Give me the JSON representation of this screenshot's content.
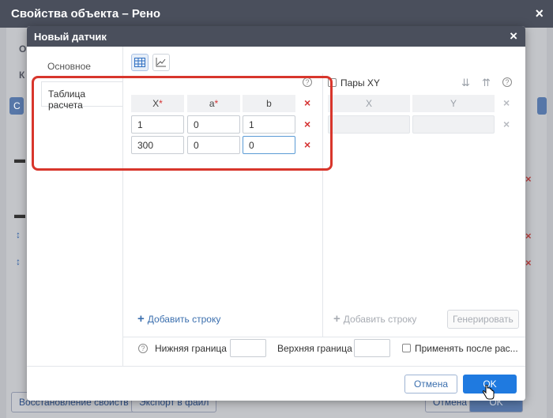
{
  "outer_dialog": {
    "title": "Свойства объекта – Рено",
    "fragment_1": "О",
    "fragment_2": "К",
    "fragment_3": "С",
    "restore_button": "Восстановление свойств",
    "export_button": "Экспорт в файл",
    "cancel_button": "Отмена",
    "ok_button": "OK"
  },
  "dialog": {
    "title": "Новый датчик",
    "close": "×",
    "nav": [
      {
        "label": "Основное"
      },
      {
        "label": "Таблица расчета"
      }
    ],
    "toolbar": {
      "icons": [
        "table-view-icon",
        "chart-view-icon"
      ]
    },
    "calc_table": {
      "headers": [
        {
          "label": "X",
          "required": true
        },
        {
          "label": "a",
          "required": true
        },
        {
          "label": "b",
          "required": false
        }
      ],
      "required_mark": "*",
      "rows": [
        [
          "1",
          "0",
          "1"
        ],
        [
          "300",
          "0",
          "0"
        ]
      ],
      "add_row": "Добавить строку"
    },
    "xy_pairs": {
      "checkbox_label": "Пары XY",
      "checked": false,
      "headers": [
        "X",
        "Y"
      ],
      "add_row": "Добавить строку",
      "generate": "Генерировать"
    },
    "help_icon": "?",
    "footer": {
      "lower_bound_label": "Нижняя граница",
      "lower_bound_value": "",
      "upper_bound_label": "Верхняя граница",
      "upper_bound_value": "",
      "apply_after_label": "Применять после рас...",
      "apply_after_checked": false
    },
    "buttons": {
      "cancel": "Отмена",
      "ok": "OK"
    }
  },
  "colors": {
    "title_bar": "#4a4f5c",
    "accent_blue": "#1f7ae0",
    "delete_red": "#d53333",
    "highlight_red": "#d8362c"
  }
}
